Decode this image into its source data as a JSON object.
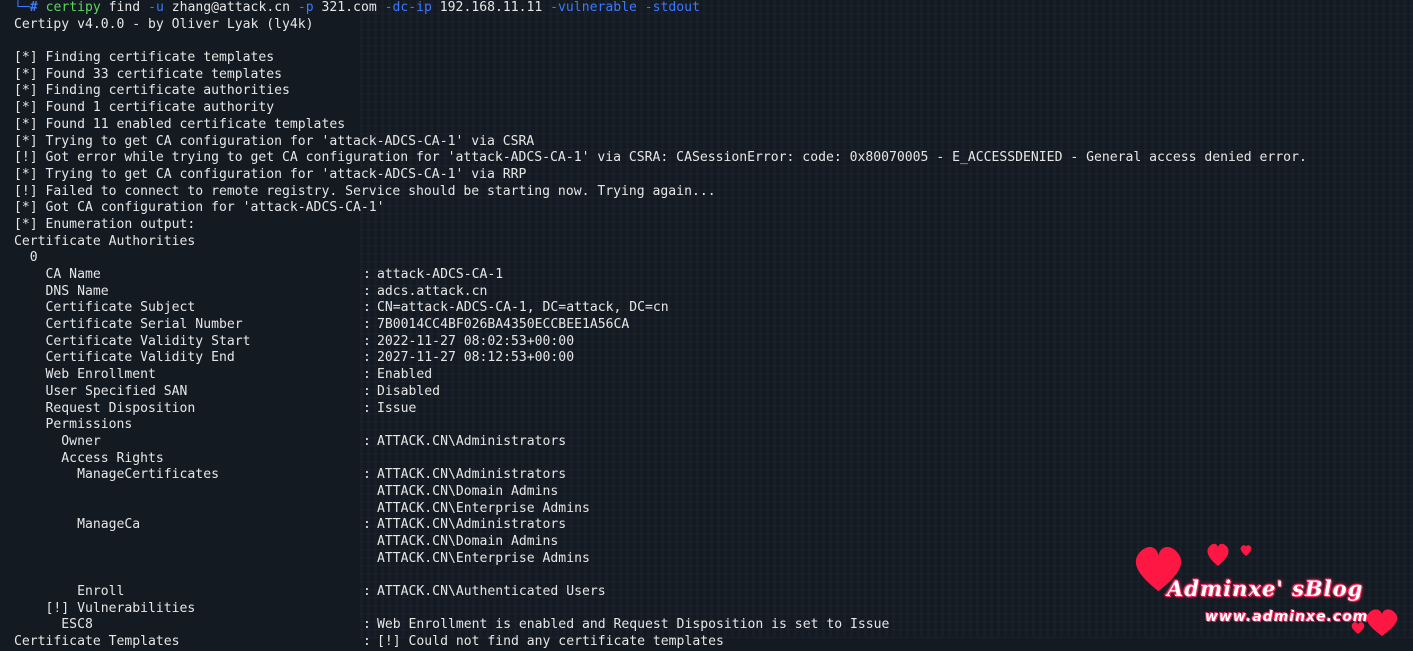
{
  "prompt": {
    "corner": "└─",
    "hash": "#",
    "command": "certipy",
    "args": " find ",
    "flag_u": "-u",
    "user": " zhang@attack.cn ",
    "flag_p": "-p",
    "password": " 321.com ",
    "flag_dc": "-dc-ip",
    "dc_ip": " 192.168.11.11 ",
    "flag_vuln": "-vulnerable",
    "space": " ",
    "flag_stdout": "-stdout"
  },
  "banner": "Certipy v4.0.0 - by Oliver Lyak (ly4k)",
  "log": [
    "[*] Finding certificate templates",
    "[*] Found 33 certificate templates",
    "[*] Finding certificate authorities",
    "[*] Found 1 certificate authority",
    "[*] Found 11 enabled certificate templates",
    "[*] Trying to get CA configuration for 'attack-ADCS-CA-1' via CSRA",
    "[!] Got error while trying to get CA configuration for 'attack-ADCS-CA-1' via CSRA: CASessionError: code: 0x80070005 - E_ACCESSDENIED - General access denied error.",
    "[*] Trying to get CA configuration for 'attack-ADCS-CA-1' via RRP",
    "[!] Failed to connect to remote registry. Service should be starting now. Trying again...",
    "[*] Got CA configuration for 'attack-ADCS-CA-1'",
    "[*] Enumeration output:"
  ],
  "section_ca": "Certificate Authorities",
  "ca_index": "  0",
  "ca_fields": [
    {
      "key": "    CA Name",
      "value": "attack-ADCS-CA-1"
    },
    {
      "key": "    DNS Name",
      "value": "adcs.attack.cn"
    },
    {
      "key": "    Certificate Subject",
      "value": "CN=attack-ADCS-CA-1, DC=attack, DC=cn"
    },
    {
      "key": "    Certificate Serial Number",
      "value": "7B0014CC4BF026BA4350ECCBEE1A56CA"
    },
    {
      "key": "    Certificate Validity Start",
      "value": "2022-11-27 08:02:53+00:00"
    },
    {
      "key": "    Certificate Validity End",
      "value": "2027-11-27 08:12:53+00:00"
    },
    {
      "key": "    Web Enrollment",
      "value": "Enabled"
    },
    {
      "key": "    User Specified SAN",
      "value": "Disabled"
    },
    {
      "key": "    Request Disposition",
      "value": "Issue"
    }
  ],
  "permissions_label": "    Permissions",
  "owner": {
    "key": "      Owner",
    "value": "ATTACK.CN\\Administrators"
  },
  "access_rights_label": "      Access Rights",
  "manage_certificates": {
    "key": "        ManageCertificates",
    "values": [
      "ATTACK.CN\\Administrators",
      "ATTACK.CN\\Domain Admins",
      "ATTACK.CN\\Enterprise Admins"
    ]
  },
  "manage_ca": {
    "key": "        ManageCa",
    "values": [
      "ATTACK.CN\\Administrators",
      "ATTACK.CN\\Domain Admins",
      "ATTACK.CN\\Enterprise Admins"
    ]
  },
  "enroll": {
    "key": "        Enroll",
    "value": "ATTACK.CN\\Authenticated Users"
  },
  "vulnerabilities_label": "    [!] Vulnerabilities",
  "esc8": {
    "key": "      ESC8",
    "value": "Web Enrollment is enabled and Request Disposition is set to Issue"
  },
  "templates": {
    "key": "Certificate Templates",
    "value": "[!] Could not find any certificate templates"
  },
  "separator": ":",
  "watermark": {
    "title": "Adminxe' sBlog",
    "url": "www.adminxe.com"
  }
}
